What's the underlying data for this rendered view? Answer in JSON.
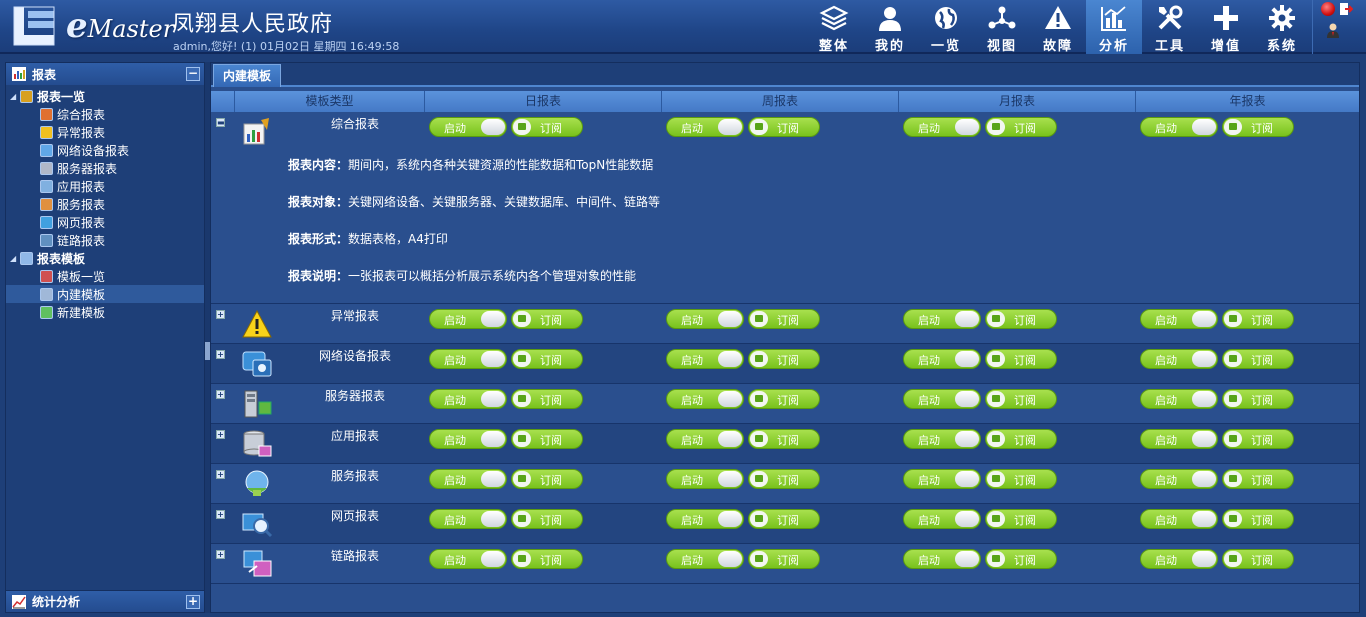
{
  "header": {
    "logo_text": "Master",
    "logo_e": "e",
    "org_title": "凤翔县人民政府",
    "welcome": "admin,您好! (1) 01月02日 星期四 16:49:58",
    "nav": [
      {
        "label": "整体",
        "icon": "layers-icon"
      },
      {
        "label": "我的",
        "icon": "user-icon"
      },
      {
        "label": "一览",
        "icon": "globe-icon"
      },
      {
        "label": "视图",
        "icon": "topology-icon"
      },
      {
        "label": "故障",
        "icon": "warning-icon"
      },
      {
        "label": "分析",
        "icon": "bar-chart-icon",
        "active": true
      },
      {
        "label": "工具",
        "icon": "tools-icon"
      },
      {
        "label": "增值",
        "icon": "plus-icon"
      },
      {
        "label": "系统",
        "icon": "gear-icon"
      }
    ]
  },
  "sidebar": {
    "title": "报表",
    "footer": "统计分析",
    "tree": [
      {
        "label": "报表一览",
        "level": 0,
        "bold": true,
        "color": "#d8a020"
      },
      {
        "label": "综合报表",
        "level": 1,
        "color": "#e07030"
      },
      {
        "label": "异常报表",
        "level": 1,
        "color": "#f0c020"
      },
      {
        "label": "网络设备报表",
        "level": 1,
        "color": "#60a8e8"
      },
      {
        "label": "服务器报表",
        "level": 1,
        "color": "#b0b8c8"
      },
      {
        "label": "应用报表",
        "level": 1,
        "color": "#80b0e0"
      },
      {
        "label": "服务报表",
        "level": 1,
        "color": "#e09040"
      },
      {
        "label": "网页报表",
        "level": 1,
        "color": "#40a0e0"
      },
      {
        "label": "链路报表",
        "level": 1,
        "color": "#6090c0"
      },
      {
        "label": "报表模板",
        "level": 0,
        "bold": true,
        "color": "#90b8e8"
      },
      {
        "label": "模板一览",
        "level": 1,
        "color": "#d05050"
      },
      {
        "label": "内建模板",
        "level": 1,
        "selected": true,
        "color": "#a0b8d8"
      },
      {
        "label": "新建模板",
        "level": 1,
        "color": "#60c060"
      }
    ]
  },
  "main": {
    "tab": "内建模板",
    "columns": [
      "模板类型",
      "日报表",
      "周报表",
      "月报表",
      "年报表"
    ],
    "switch_label": "启动",
    "subscribe_label": "订阅",
    "rows": [
      {
        "name": "综合报表",
        "icon": "report-chart-icon",
        "expanded": true,
        "expander": "▬",
        "details": [
          {
            "key": "报表内容：",
            "value": "期间内，系统内各种关键资源的性能数据和TopN性能数据"
          },
          {
            "key": "报表对象：",
            "value": "关键网络设备、关键服务器、关键数据库、中间件、链路等"
          },
          {
            "key": "报表形式：",
            "value": "数据表格，A4打印"
          },
          {
            "key": "报表说明：",
            "value": "一张报表可以概括分析展示系统内各个管理对象的性能"
          }
        ]
      },
      {
        "name": "异常报表",
        "icon": "warning-icon",
        "expander": "+"
      },
      {
        "name": "网络设备报表",
        "icon": "network-device-icon",
        "expander": "+"
      },
      {
        "name": "服务器报表",
        "icon": "server-icon",
        "expander": "+"
      },
      {
        "name": "应用报表",
        "icon": "database-icon",
        "expander": "+"
      },
      {
        "name": "服务报表",
        "icon": "service-icon",
        "expander": "+"
      },
      {
        "name": "网页报表",
        "icon": "web-search-icon",
        "expander": "+"
      },
      {
        "name": "链路报表",
        "icon": "link-icon",
        "expander": "+"
      }
    ]
  }
}
